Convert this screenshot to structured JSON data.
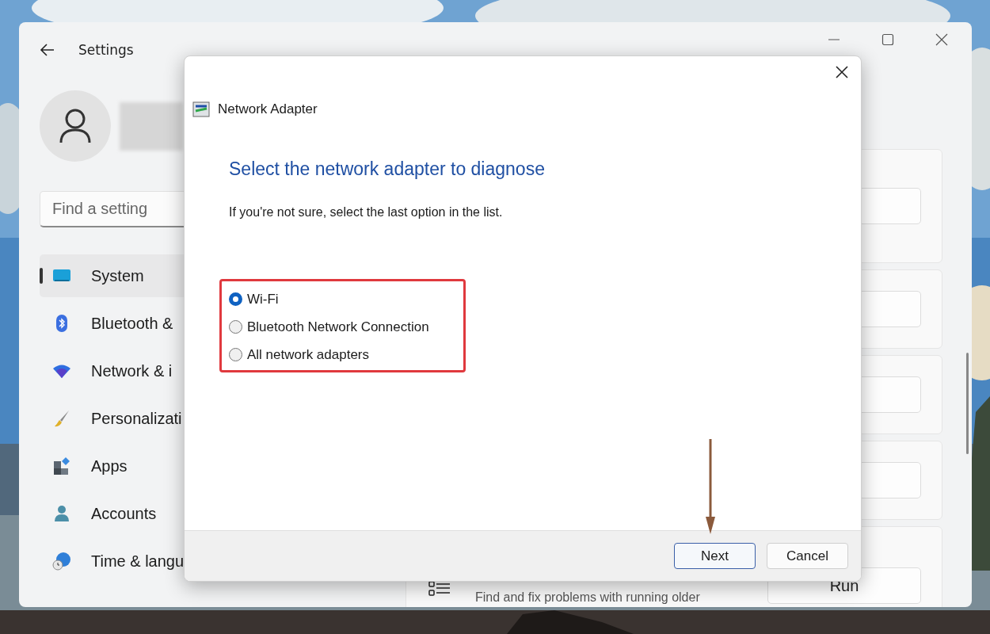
{
  "settings_window": {
    "title": "Settings",
    "search": {
      "placeholder": "Find a setting"
    },
    "nav_items": [
      {
        "label": "System",
        "selected": true
      },
      {
        "label": "Bluetooth &",
        "selected": false
      },
      {
        "label": "Network & i",
        "selected": false
      },
      {
        "label": "Personalizati",
        "selected": false
      },
      {
        "label": "Apps",
        "selected": false
      },
      {
        "label": "Accounts",
        "selected": false
      },
      {
        "label": "Time & langu",
        "selected": false
      }
    ],
    "troubleshooter": {
      "description": "Find and fix problems with running older",
      "button": "Run"
    }
  },
  "dialog": {
    "title": "Network Adapter",
    "heading": "Select the network adapter to diagnose",
    "instruction": "If you're not sure, select the last option in the list.",
    "options": [
      {
        "label": "Wi-Fi",
        "selected": true
      },
      {
        "label": "Bluetooth Network Connection",
        "selected": false
      },
      {
        "label": "All network adapters",
        "selected": false
      }
    ],
    "buttons": [
      {
        "label": "Next",
        "default": true
      },
      {
        "label": "Cancel",
        "default": false
      }
    ]
  }
}
